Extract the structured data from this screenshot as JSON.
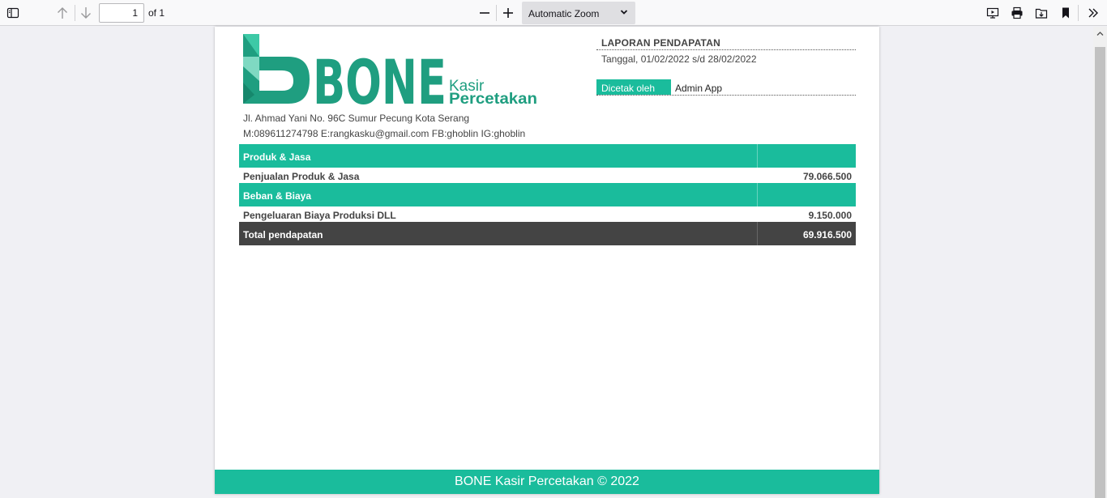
{
  "toolbar": {
    "page_number": "1",
    "page_count_label": "of 1",
    "zoom_label": "Automatic Zoom"
  },
  "document": {
    "brand_wordmark": "BONE",
    "brand_sub_1": "Kasir",
    "brand_sub_2": "Percetakan",
    "address_line_1": "Jl. Ahmad Yani No. 96C Sumur Pecung Kota Serang",
    "address_line_2": "M:089611274798 E:rangkasku@gmail.com FB:ghoblin IG:ghoblin",
    "report_title": "LAPORAN PENDAPATAN",
    "report_date": "Tanggal, 01/02/2022 s/d 28/02/2022",
    "printed_by_label": "Dicetak oleh",
    "printed_by_value": "Admin App",
    "sections": [
      {
        "heading": "Produk & Jasa",
        "item_label": "Penjualan Produk & Jasa",
        "item_value": "79.066.500"
      },
      {
        "heading": "Beban & Biaya",
        "item_label": "Pengeluaran Biaya Produksi DLL",
        "item_value": "9.150.000"
      }
    ],
    "total_label": "Total pendapatan",
    "total_value": "69.916.500",
    "footer_text": "BONE Kasir Percetakan © 2022"
  },
  "colors": {
    "accent": "#1abc9c",
    "brand": "#1f9e80",
    "total_row": "#444444"
  },
  "icons": [
    "sidebar-toggle-icon",
    "arrow-up-icon",
    "arrow-down-icon",
    "zoom-out-icon",
    "zoom-in-icon",
    "chevron-down-icon",
    "presentation-icon",
    "print-icon",
    "save-icon",
    "bookmark-icon",
    "tools-chevron-icon"
  ]
}
